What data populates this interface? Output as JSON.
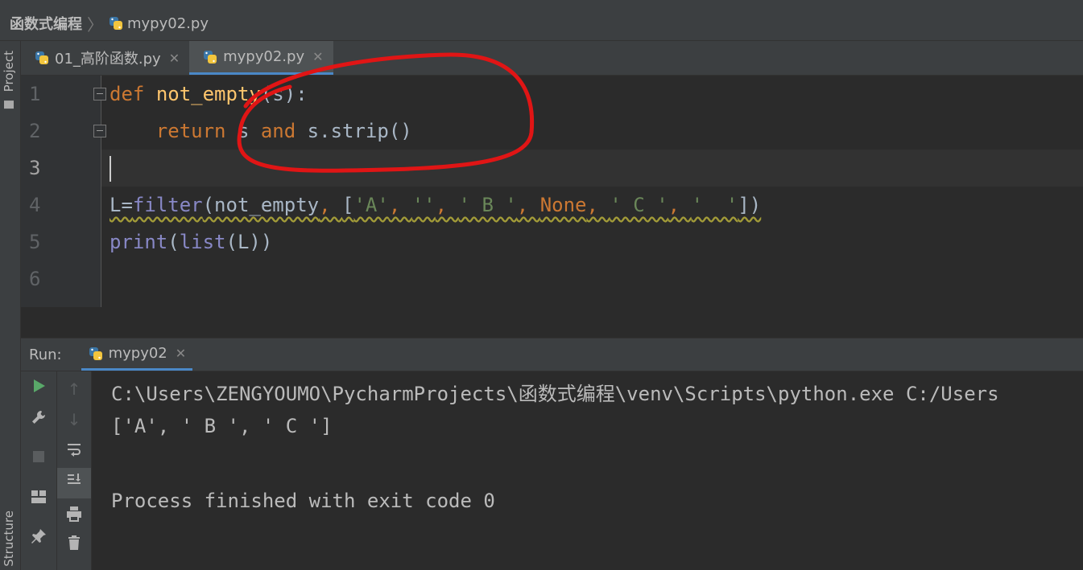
{
  "breadcrumb": {
    "project": "函数式编程",
    "file": "mypy02.py"
  },
  "side_labels": {
    "project": "Project",
    "structure": "Structure"
  },
  "tabs": [
    {
      "label": "01_高阶函数.py",
      "active": false
    },
    {
      "label": "mypy02.py",
      "active": true
    }
  ],
  "editor": {
    "line_numbers": [
      "1",
      "2",
      "3",
      "4",
      "5",
      "6"
    ],
    "line1": {
      "kw": "def",
      "fn": "not_empty",
      "rest": "(s):"
    },
    "line2": {
      "indent": "    ",
      "kw1": "return",
      "a": " s ",
      "kw2": "and",
      "b": " s.strip()"
    },
    "line4": {
      "p1": "L=",
      "builtin": "filter",
      "p2": "(not_empty",
      "comma1": ", ",
      "p3": "[",
      "s1": "'A'",
      "c1": ", ",
      "s2": "''",
      "c2": ", ",
      "s3": "' B '",
      "c3": ", ",
      "none": "None",
      "c4": ", ",
      "s4": "' C '",
      "c5": ", ",
      "s5": "'  '",
      "p4": "])"
    },
    "line5": {
      "builtin1": "print",
      "p1": "(",
      "builtin2": "list",
      "p2": "(L))"
    }
  },
  "run": {
    "label": "Run:",
    "tab": "mypy02",
    "output": [
      "C:\\Users\\ZENGYOUMO\\PycharmProjects\\函数式编程\\venv\\Scripts\\python.exe C:/Users",
      "['A', ' B ', ' C ']",
      "",
      "Process finished with exit code 0"
    ]
  },
  "colors": {
    "keyword": "#cc7832",
    "function": "#ffc66d",
    "builtin": "#8888c6",
    "string": "#6a8759",
    "annotation": "#e01515",
    "accent": "#4a88c7"
  },
  "icons": {
    "run": "play-icon",
    "wrench": "wrench-icon",
    "stop": "stop-icon",
    "layout": "layout-icon",
    "pin": "pin-icon",
    "up": "arrow-up-icon",
    "down": "arrow-down-icon",
    "wrap": "soft-wrap-icon",
    "scroll": "scroll-to-end-icon",
    "print": "print-icon",
    "trash": "trash-icon",
    "python": "python-file-icon"
  }
}
